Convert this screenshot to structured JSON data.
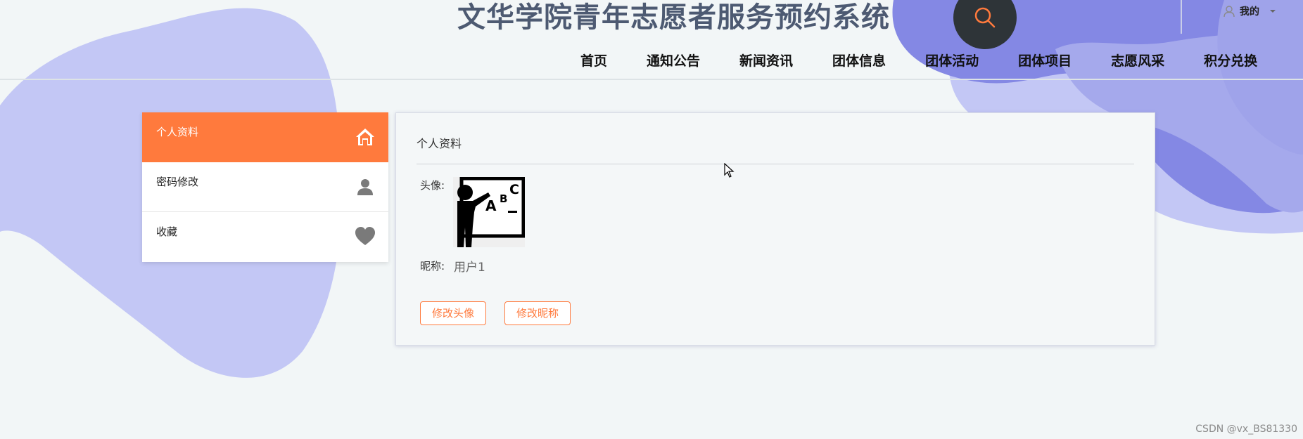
{
  "header": {
    "site_title": "文华学院青年志愿者服务预约系统",
    "user_label": "我的",
    "icons": {
      "search": "search-icon",
      "user": "user-icon",
      "caret": "caret-down-icon"
    }
  },
  "nav": {
    "items": [
      {
        "label": "首页"
      },
      {
        "label": "通知公告"
      },
      {
        "label": "新闻资讯"
      },
      {
        "label": "团体信息"
      },
      {
        "label": "团体活动"
      },
      {
        "label": "团体项目"
      },
      {
        "label": "志愿风采"
      },
      {
        "label": "积分兑换"
      }
    ]
  },
  "sidebar": {
    "items": [
      {
        "label": "个人资料",
        "icon": "home-icon",
        "active": true
      },
      {
        "label": "密码修改",
        "icon": "person-icon",
        "active": false
      },
      {
        "label": "收藏",
        "icon": "heart-icon",
        "active": false
      }
    ]
  },
  "profile": {
    "title": "个人资料",
    "avatar_label": "头像:",
    "nickname_label": "昵称:",
    "nickname_value": "用户1",
    "edit_avatar_button": "修改头像",
    "edit_nickname_button": "修改昵称"
  },
  "watermark": "CSDN @vx_BS81330",
  "colors": {
    "accent": "#ff7a3d",
    "background": "#f2f6f7",
    "blob_light": "#c3c7f5",
    "blob_dark": "#8488e4",
    "search_bg": "#2e3438",
    "title": "#4d5a72"
  }
}
